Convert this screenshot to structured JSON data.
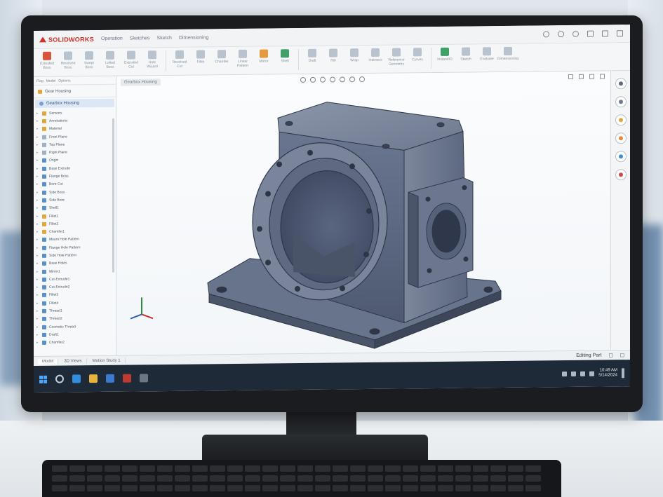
{
  "app": {
    "brand": "SOLIDWORKS",
    "menu": [
      "Operation",
      "Sketches",
      "Sketch",
      "Dimensioning"
    ],
    "window_controls": [
      "help-icon",
      "settings-icon",
      "minimize-icon",
      "maximize-icon",
      "close-icon"
    ]
  },
  "ribbon": {
    "buttons": [
      {
        "label": "Extruded Boss",
        "color": "red"
      },
      {
        "label": "Revolved Boss",
        "color": "gray"
      },
      {
        "label": "Swept Boss",
        "color": "gray"
      },
      {
        "label": "Lofted Boss",
        "color": "gray"
      },
      {
        "label": "Extruded Cut",
        "color": "gray"
      },
      {
        "label": "Hole Wizard",
        "color": "gray"
      },
      {
        "label": "Revolved Cut",
        "color": "gray"
      },
      {
        "label": "Fillet",
        "color": "gray"
      },
      {
        "label": "Chamfer",
        "color": "gray"
      },
      {
        "label": "Linear Pattern",
        "color": "gray"
      },
      {
        "label": "Mirror",
        "color": "orange"
      },
      {
        "label": "Shell",
        "color": "green"
      },
      {
        "label": "Draft",
        "color": "gray"
      },
      {
        "label": "Rib",
        "color": "gray"
      },
      {
        "label": "Wrap",
        "color": "gray"
      },
      {
        "label": "Intersect",
        "color": "gray"
      },
      {
        "label": "Reference Geometry",
        "color": "gray"
      },
      {
        "label": "Curves",
        "color": "gray"
      },
      {
        "label": "Instant3D",
        "color": "green"
      },
      {
        "label": "Sketch",
        "color": "gray"
      },
      {
        "label": "Evaluate",
        "color": "gray"
      },
      {
        "label": "Dimensioning",
        "color": "gray"
      }
    ]
  },
  "feature_manager": {
    "tabs": [
      "Flag",
      "Model",
      "Options"
    ],
    "header": "Gear Housing",
    "part_name": "Gearbox Housing",
    "items": [
      {
        "label": "Sensors",
        "icon": "feat"
      },
      {
        "label": "Annotations",
        "icon": "feat"
      },
      {
        "label": "Material",
        "icon": "feat"
      },
      {
        "label": "Front Plane",
        "icon": "plane"
      },
      {
        "label": "Top Plane",
        "icon": "plane"
      },
      {
        "label": "Right Plane",
        "icon": "plane"
      },
      {
        "label": "Origin",
        "icon": "sketch"
      },
      {
        "label": "Base Extrude",
        "icon": "sketch"
      },
      {
        "label": "Flange Boss",
        "icon": "sketch"
      },
      {
        "label": "Bore Cut",
        "icon": "sketch"
      },
      {
        "label": "Side Boss",
        "icon": "sketch"
      },
      {
        "label": "Side Bore",
        "icon": "sketch"
      },
      {
        "label": "Shell1",
        "icon": "sketch"
      },
      {
        "label": "Fillet1",
        "icon": "feat"
      },
      {
        "label": "Fillet2",
        "icon": "feat"
      },
      {
        "label": "Chamfer1",
        "icon": "feat"
      },
      {
        "label": "Mount Hole Pattern",
        "icon": "sketch"
      },
      {
        "label": "Flange Hole Pattern",
        "icon": "sketch"
      },
      {
        "label": "Side Hole Pattern",
        "icon": "sketch"
      },
      {
        "label": "Base Holes",
        "icon": "sketch"
      },
      {
        "label": "Mirror1",
        "icon": "sketch"
      },
      {
        "label": "Cut-Extrude1",
        "icon": "sketch"
      },
      {
        "label": "Cut-Extrude2",
        "icon": "sketch"
      },
      {
        "label": "Fillet3",
        "icon": "sketch"
      },
      {
        "label": "Fillet4",
        "icon": "sketch"
      },
      {
        "label": "Thread1",
        "icon": "sketch"
      },
      {
        "label": "Thread2",
        "icon": "sketch"
      },
      {
        "label": "Cosmetic Thread",
        "icon": "sketch"
      },
      {
        "label": "Draft1",
        "icon": "sketch"
      },
      {
        "label": "Chamfer2",
        "icon": "sketch"
      }
    ]
  },
  "graphics": {
    "breadcrumb": "Gearbox Housing",
    "model_color": "#6f7a90"
  },
  "sheet_tabs": [
    "Model",
    "3D Views",
    "Motion Study 1"
  ],
  "status": {
    "label": "Editing Part"
  },
  "taskbar": {
    "clock_time": "10:49 AM",
    "clock_date": "5/14/2024"
  }
}
